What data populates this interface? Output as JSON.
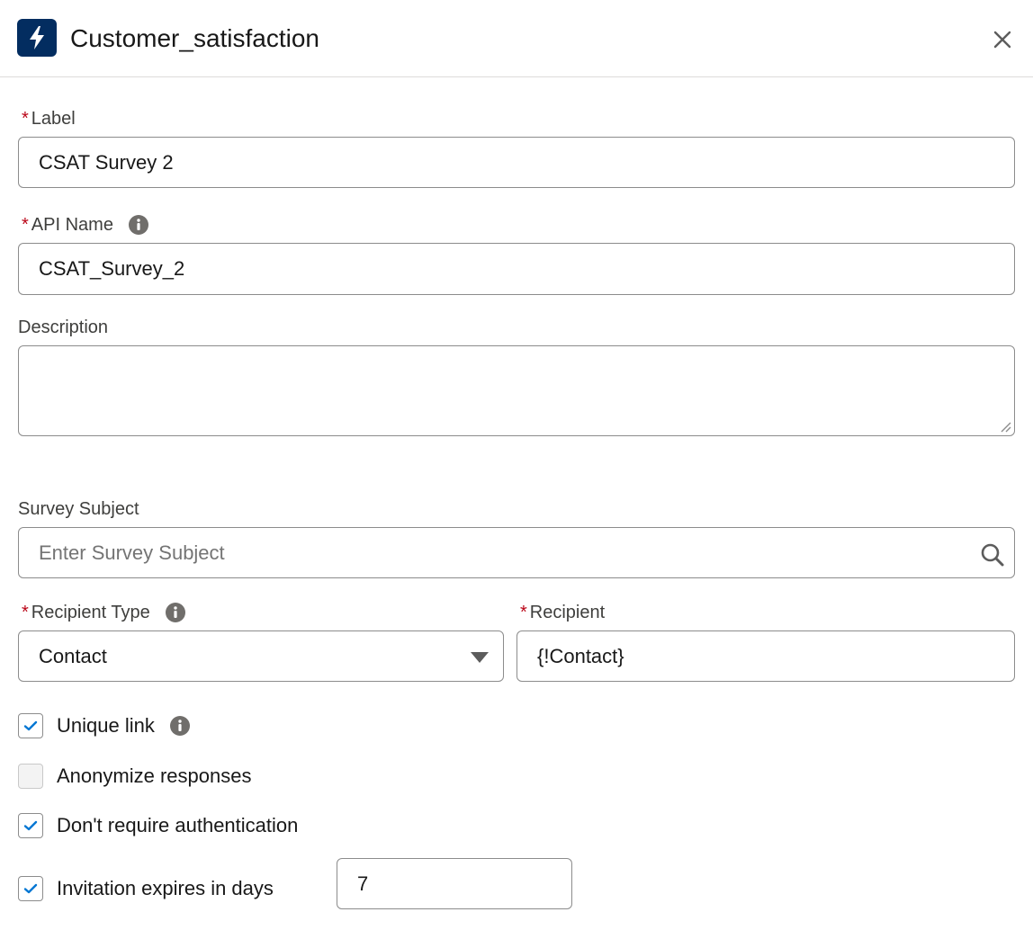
{
  "header": {
    "title": "Customer_satisfaction",
    "app_icon": "lightning-bolt-icon",
    "close_icon": "close-icon"
  },
  "form": {
    "label": {
      "label": "Label",
      "required": "*",
      "value": "CSAT Survey 2"
    },
    "api_name": {
      "label": "API Name",
      "required": "*",
      "value": "CSAT_Survey_2"
    },
    "description": {
      "label": "Description",
      "value": ""
    },
    "survey_subject": {
      "label": "Survey Subject",
      "placeholder": "Enter Survey Subject"
    },
    "recipient_type": {
      "label": "Recipient Type",
      "required": "*",
      "value": "Contact"
    },
    "recipient": {
      "label": "Recipient",
      "required": "*",
      "value": "{!Contact}"
    },
    "checkboxes": [
      {
        "label": "Unique link",
        "checked": true
      },
      {
        "label": "Anonymize responses",
        "checked": false
      },
      {
        "label": "Don't require authentication",
        "checked": true
      },
      {
        "label": "Invitation expires in days",
        "checked": true
      }
    ],
    "expires_days": {
      "value": "7"
    }
  },
  "colors": {
    "brand_dark": "#032d60",
    "check_blue": "#0176d3",
    "required_red": "#ba0517",
    "border": "#8c8c8c"
  }
}
